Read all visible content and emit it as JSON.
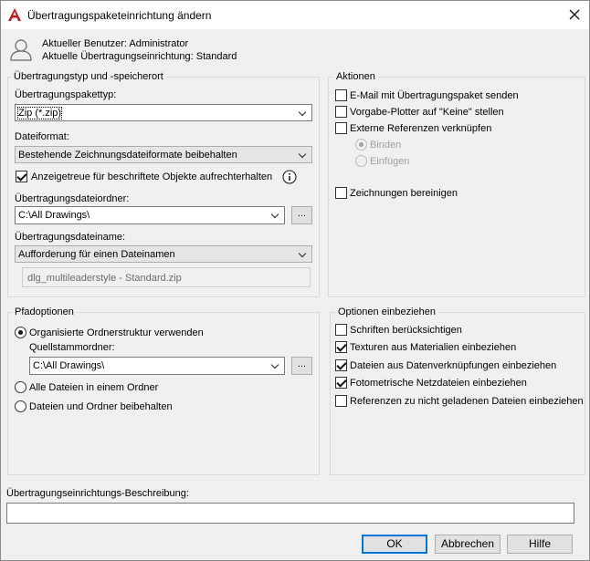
{
  "window": {
    "title": "Übertragungspaketeinrichtung ändern"
  },
  "icons": {
    "app": "autocad-a-icon",
    "close": "close-icon",
    "user": "user-icon",
    "info": "info-icon",
    "dropdown": "chevron-down-icon"
  },
  "header": {
    "current_user": "Aktueller Benutzer: Administrator",
    "current_setup": "Aktuelle Übertragungseinrichtung: Standard"
  },
  "transfer_type": {
    "group_title": "Übertragungstyp und -speicherort",
    "package_type_label": "Übertragungspakettyp:",
    "package_type_value": "Zip (*.zip)",
    "file_format_label": "Dateiformat:",
    "file_format_value": "Bestehende Zeichnungsdateiformate beibehalten",
    "annotative_label": "Anzeigetreue für beschriftete Objekte aufrechterhalten",
    "folder_label": "Übertragungsdateiordner:",
    "folder_value": "C:\\All Drawings\\",
    "browse_label": "...",
    "filename_label": "Übertragungsdateiname:",
    "filename_value": "Aufforderung für einen Dateinamen",
    "filename_preview": "dlg_multileaderstyle - Standard.zip"
  },
  "actions": {
    "group_title": "Aktionen",
    "email_label": "E-Mail mit Übertragungspaket senden",
    "plotter_label": "Vorgabe-Plotter auf \"Keine\" stellen",
    "xref_label": "Externe Referenzen verknüpfen",
    "bind_label": "Binden",
    "insert_label": "Einfügen",
    "purge_label": "Zeichnungen bereinigen"
  },
  "path_options": {
    "group_title": "Pfadoptionen",
    "organized_label": "Organisierte Ordnerstruktur verwenden",
    "source_root_label": "Quellstammordner:",
    "source_root_value": "C:\\All Drawings\\",
    "browse_label": "...",
    "single_folder_label": "Alle Dateien in einem Ordner",
    "keep_structure_label": "Dateien und Ordner beibehalten"
  },
  "include_options": {
    "group_title": "Optionen einbeziehen",
    "fonts_label": "Schriften berücksichtigen",
    "textures_label": "Texturen aus Materialien einbeziehen",
    "datalinks_label": "Dateien aus Datenverknüpfungen einbeziehen",
    "photometric_label": "Fotometrische Netzdateien einbeziehen",
    "unloaded_refs_label": "Referenzen zu nicht geladenen Dateien einbeziehen"
  },
  "description": {
    "label": "Übertragungseinrichtungs-Beschreibung:",
    "value": ""
  },
  "buttons": {
    "ok": "OK",
    "cancel": "Abbrechen",
    "help": "Hilfe"
  },
  "colors": {
    "accent": "#0078d7",
    "app_icon": "#c4161c"
  }
}
